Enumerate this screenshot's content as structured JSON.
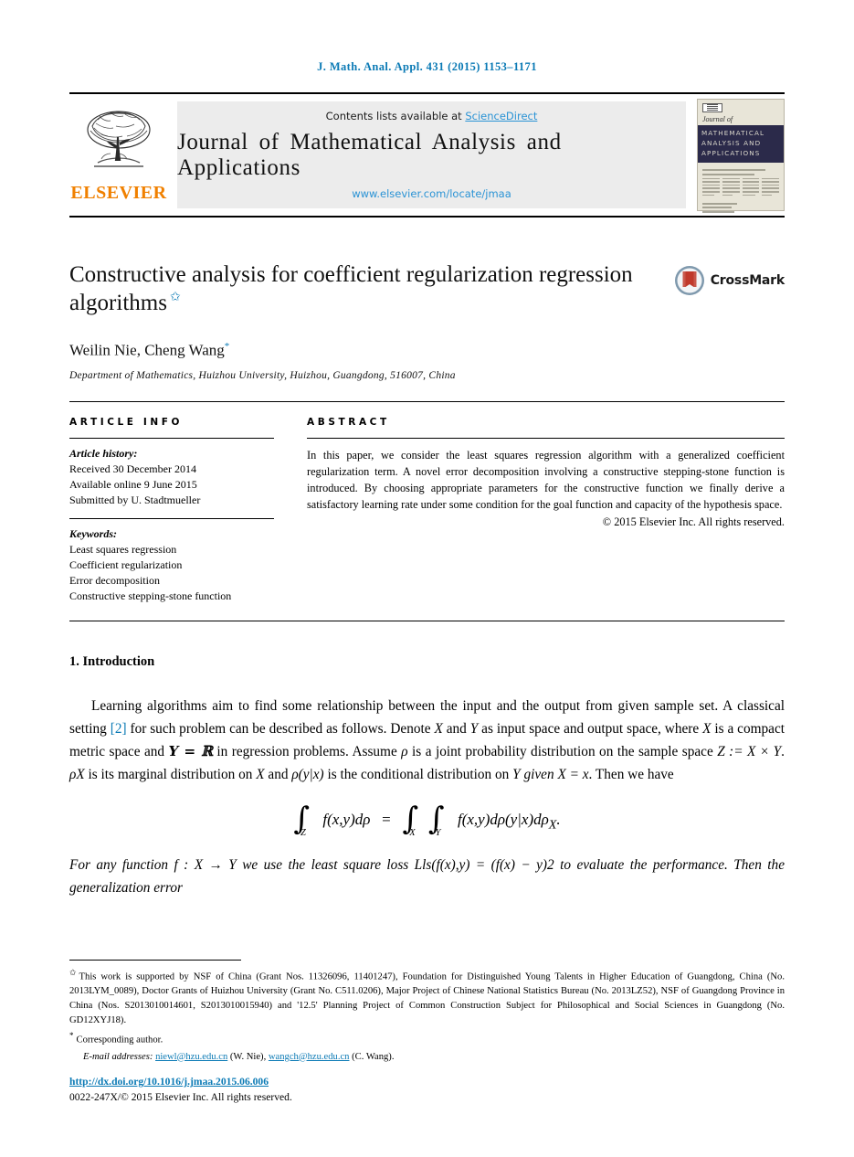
{
  "running_head": "J. Math. Anal. Appl. 431 (2015) 1153–1171",
  "masthead": {
    "publisher": "ELSEVIER",
    "contents_prefix": "Contents lists available at ",
    "contents_link": "ScienceDirect",
    "journal_name": "Journal of Mathematical Analysis and Applications",
    "journal_url": "www.elsevier.com/locate/jmaa",
    "cover": {
      "journal_of": "Journal of",
      "band_line1": "MATHEMATICAL",
      "band_line2": "ANALYSIS AND",
      "band_line3": "APPLICATIONS"
    }
  },
  "article": {
    "title": "Constructive analysis for coefficient regularization regression algorithms",
    "title_star": "✩",
    "crossmark_label": "CrossMark",
    "authors": "Weilin Nie, Cheng Wang",
    "corresponding_mark": "*",
    "affiliation": "Department of Mathematics, Huizhou University, Huizhou, Guangdong, 516007, China"
  },
  "info": {
    "heading": "ARTICLE INFO",
    "history_label": "Article history:",
    "history": [
      "Received 30 December 2014",
      "Available online 9 June 2015",
      "Submitted by U. Stadtmueller"
    ],
    "keywords_label": "Keywords:",
    "keywords": [
      "Least squares regression",
      "Coefficient regularization",
      "Error decomposition",
      "Constructive stepping-stone function"
    ]
  },
  "abstract": {
    "heading": "ABSTRACT",
    "text": "In this paper, we consider the least squares regression algorithm with a generalized coefficient regularization term. A novel error decomposition involving a constructive stepping-stone function is introduced. By choosing appropriate parameters for the constructive function we finally derive a satisfactory learning rate under some condition for the goal function and capacity of the hypothesis space.",
    "copyright": "© 2015 Elsevier Inc. All rights reserved."
  },
  "body": {
    "section_title": "1. Introduction",
    "paragraph1_a": "Learning algorithms aim to find some relationship between the input and the output from given sample set. A classical setting ",
    "citation": "[2]",
    "paragraph1_b": " for such problem can be described as follows. Denote ",
    "p1_X": "X",
    "p1_and": " and ",
    "p1_Y": "Y",
    "paragraph1_c": " as input space and output space, where ",
    "paragraph1_d": " is a compact metric space and ",
    "p1_YR": "Y = ℝ",
    "paragraph1_e": " in regression problems. Assume ",
    "p1_rho": "ρ",
    "paragraph1_f": " is a joint probability distribution on the sample space ",
    "p1_Z": "Z := X × Y",
    "paragraph1_g": ". ",
    "p1_rhoX": "ρX",
    "paragraph1_h": " is its marginal distribution on ",
    "paragraph1_i": " and ",
    "p1_cond": "ρ(y|x)",
    "paragraph1_j": " is the conditional distribution on ",
    "p1_given": "Y given X = x",
    "paragraph1_k": ". Then we have",
    "equation": "∫Z f(x,y)dρ = ∫X ∫Y f(x,y)dρ(y|x)dρX.",
    "paragraph2": "For any function f : X → Y we use the least square loss Lls(f(x),y) = (f(x) − y)2 to evaluate the performance. Then the generalization error"
  },
  "footnotes": {
    "funding_mark": "✩",
    "funding": "This work is supported by NSF of China (Grant Nos. 11326096, 11401247), Foundation for Distinguished Young Talents in Higher Education of Guangdong, China (No. 2013LYM_0089), Doctor Grants of Huizhou University (Grant No. C511.0206), Major Project of Chinese National Statistics Bureau (No. 2013LZ52), NSF of Guangdong Province in China (Nos. S2013010014601, S2013010015940) and '12.5' Planning Project of Common Construction Subject for Philosophical and Social Sciences in Guangdong (No. GD12XYJ18).",
    "corresponding_mark": "*",
    "corresponding": "Corresponding author.",
    "email_label": "E-mail addresses:",
    "email1": "niewl@hzu.edu.cn",
    "email1_owner": "(W. Nie),",
    "email2": "wangch@hzu.edu.cn",
    "email2_owner": "(C. Wang).",
    "doi": "http://dx.doi.org/10.1016/j.jmaa.2015.06.006",
    "issn": "0022-247X/© 2015 Elsevier Inc. All rights reserved."
  }
}
